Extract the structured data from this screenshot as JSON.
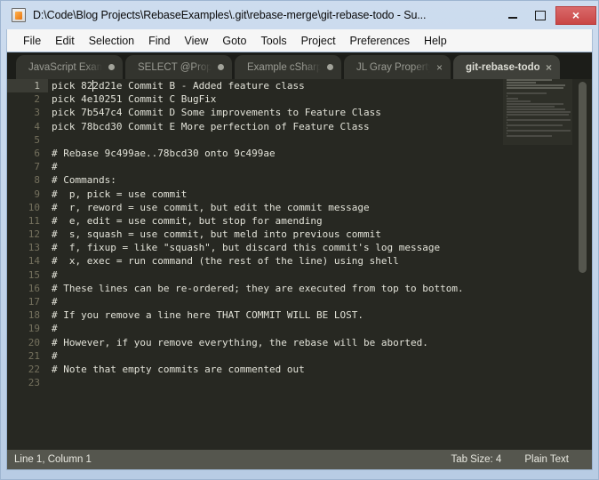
{
  "window": {
    "title": "D:\\Code\\Blog Projects\\RebaseExamples\\.git\\rebase-merge\\git-rebase-todo - Su...",
    "icon": "sublime-text-icon",
    "minimize_label": "",
    "maximize_label": "",
    "close_label": "×",
    "accent_close": "#c94545",
    "chrome_bg": "#c2d4ea"
  },
  "menubar": {
    "items": [
      {
        "label": "File"
      },
      {
        "label": "Edit"
      },
      {
        "label": "Selection"
      },
      {
        "label": "Find"
      },
      {
        "label": "View"
      },
      {
        "label": "Goto"
      },
      {
        "label": "Tools"
      },
      {
        "label": "Project"
      },
      {
        "label": "Preferences"
      },
      {
        "label": "Help"
      }
    ]
  },
  "tabs": [
    {
      "label": "JavaScript Example",
      "dirty": true,
      "close": "×",
      "active": false
    },
    {
      "label": "SELECT @Property",
      "dirty": true,
      "close": "×",
      "active": false
    },
    {
      "label": "Example cSharp Sn",
      "dirty": true,
      "close": "×",
      "active": false
    },
    {
      "label": "JL Gray Property N",
      "dirty": false,
      "close": "×",
      "active": false
    },
    {
      "label": "git-rebase-todo",
      "dirty": false,
      "close": "×",
      "active": true
    }
  ],
  "editor": {
    "current_line": 1,
    "lines": [
      "pick 822d21e Commit B - Added feature class",
      "pick 4e10251 Commit C BugFix",
      "pick 7b547c4 Commit D Some improvements to Feature Class",
      "pick 78bcd30 Commit E More perfection of Feature Class",
      "",
      "# Rebase 9c499ae..78bcd30 onto 9c499ae",
      "#",
      "# Commands:",
      "#  p, pick = use commit",
      "#  r, reword = use commit, but edit the commit message",
      "#  e, edit = use commit, but stop for amending",
      "#  s, squash = use commit, but meld into previous commit",
      "#  f, fixup = like \"squash\", but discard this commit's log message",
      "#  x, exec = run command (the rest of the line) using shell",
      "#",
      "# These lines can be re-ordered; they are executed from top to bottom.",
      "#",
      "# If you remove a line here THAT COMMIT WILL BE LOST.",
      "#",
      "# However, if you remove everything, the rebase will be aborted.",
      "#",
      "# Note that empty commits are commented out",
      ""
    ],
    "background": "#272822",
    "foreground": "#e2e2d8",
    "gutter_color": "#75715e"
  },
  "statusbar": {
    "position": "Line 1, Column 1",
    "tab_size": "Tab Size: 4",
    "syntax": "Plain Text"
  }
}
